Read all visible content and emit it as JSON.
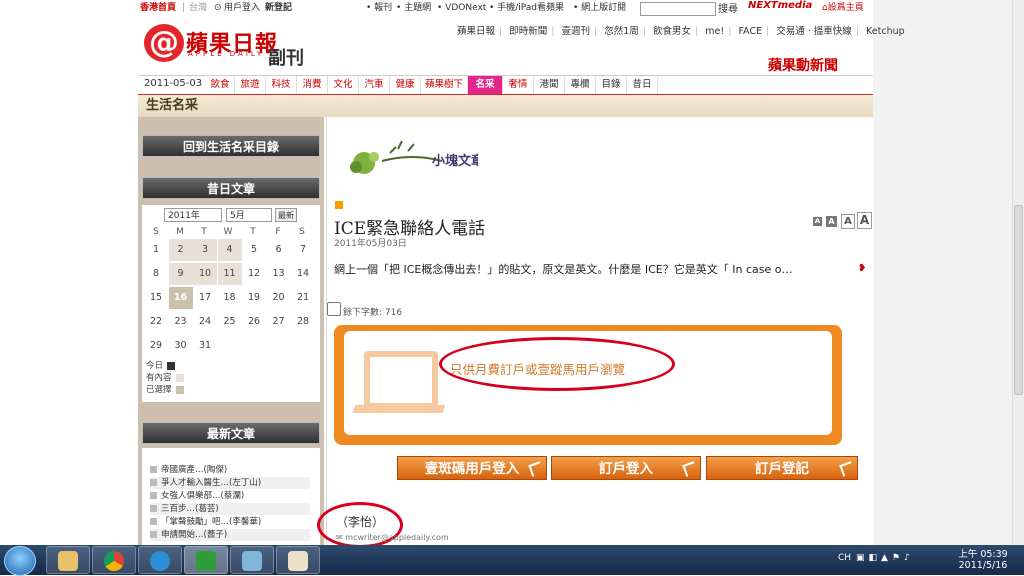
{
  "topbar": {
    "home": "香港首頁",
    "region": "台灣",
    "login": "用戶登入",
    "register": "新登記",
    "links": [
      "• 報刊",
      "• 主題網",
      "• VDONext",
      "• 手機/iPad看蘋果",
      "• 網上版訂閱"
    ],
    "search_label": "搜尋",
    "nextmedia": "NEXTmedia",
    "set_home": "設爲主頁"
  },
  "logo": {
    "mark": "@",
    "name": "蘋果日報",
    "sub": "APPLE DAILY",
    "section": "副刊"
  },
  "sitelinks": [
    "蘋果日報",
    "即時新聞",
    "壹週刊",
    "忽然1周",
    "飲食男女",
    "me!",
    "FACE",
    "交易通 · 搵車快線",
    "Ketchup"
  ],
  "promo": "蘋果動新聞",
  "navbar": {
    "date": "2011-05-03",
    "items": [
      "飲食",
      "旅遊",
      "科技",
      "消費",
      "文化",
      "汽車",
      "健康",
      "蘋果樹下",
      "名采",
      "奢情",
      "港聞",
      "專欄",
      "目錄",
      "昔日"
    ]
  },
  "section_title": "生活名采",
  "sidebar": {
    "back_label": "回到生活名采目錄",
    "archive_label": "昔日文章",
    "calendar": {
      "year": "2011年",
      "month": "5月",
      "go": "最新",
      "weekdays": [
        "S",
        "M",
        "T",
        "W",
        "T",
        "F",
        "S"
      ],
      "weeks": [
        [
          "1",
          "2",
          "3",
          "4",
          "5",
          "6",
          "7"
        ],
        [
          "8",
          "9",
          "10",
          "11",
          "12",
          "13",
          "14"
        ],
        [
          "15",
          "16",
          "17",
          "18",
          "19",
          "20",
          "21"
        ],
        [
          "22",
          "23",
          "24",
          "25",
          "26",
          "27",
          "28"
        ],
        [
          "29",
          "30",
          "31"
        ]
      ],
      "legend": {
        "today": "今日",
        "has": "有內容",
        "selected": "已選擇"
      }
    },
    "latest_label": "最新文章",
    "latest": [
      "帝國廣產…(陶傑)",
      "爭人才輸入醫生…(左丁山)",
      "女強人俱樂部…(蔡瀾)",
      "三百步…(葛芸)",
      "「掌聲鼓勵」吧…(李馨華)",
      "申請開始…(蕎子)"
    ]
  },
  "article": {
    "column_logo": "小塊文章",
    "title": "ICE緊急聯絡人電話",
    "date": "2011年05月03日",
    "font_sizes": [
      "A",
      "A",
      "A",
      "A"
    ],
    "excerpt": "網上一個「把 ICE概念傳出去！」的貼文，原文是英文。什麼是 ICE？它是英文「 In case o…",
    "remaining_label": "餘下字數: 716",
    "paywall_msg": "只供月費訂戶或壹蹤馬用戶瀏覽",
    "buttons": [
      "壹斑碼用戶登入",
      "訂戶登入",
      "訂戶登記"
    ],
    "author": "（李怡）",
    "email": "mcwriter@appledaily.com"
  },
  "taskbar": {
    "tray_lang": "CH",
    "time": "上午 05:39",
    "date": "2011/5/16"
  },
  "colors": {
    "brand_red": "#e4262c",
    "nav_pink": "#e4268c",
    "button_orange": "#e07418",
    "paywall": "#ef8a20",
    "annotation": "#d6001c"
  }
}
